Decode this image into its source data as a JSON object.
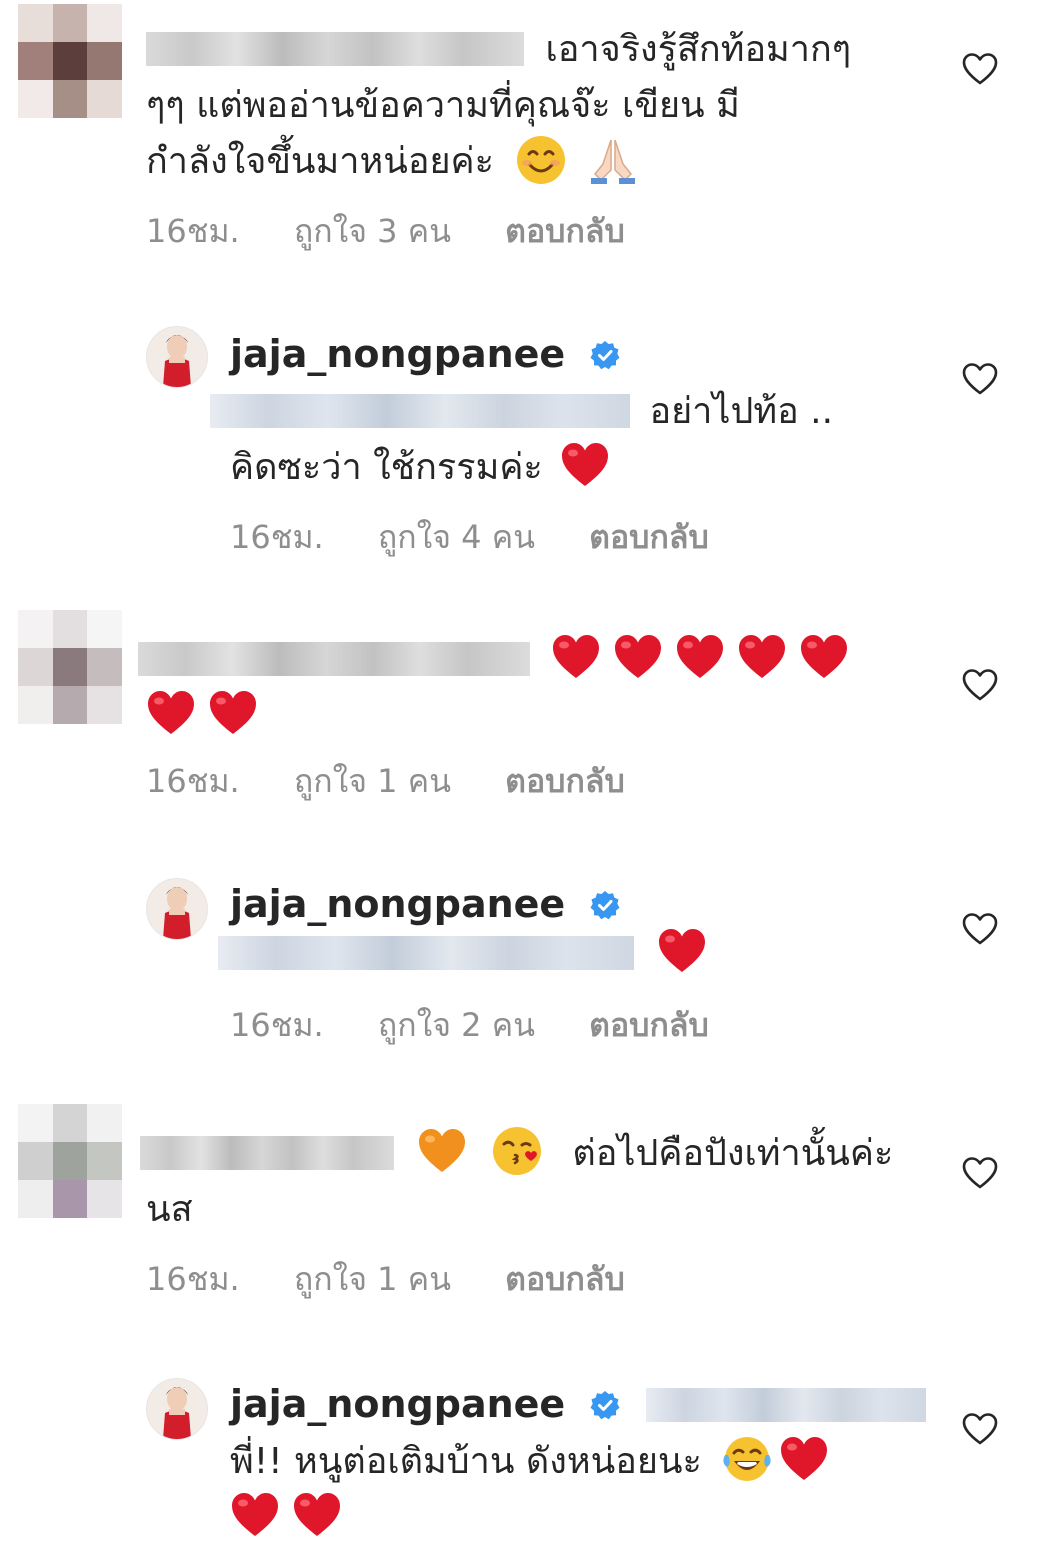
{
  "comments": [
    {
      "text_lines": [
        "เอาจริงรู้สึกท้อมากๆ",
        "ๆๆ แต่พออ่านข้อความที่คุณจ๊ะ เขียน มี",
        "กำลังใจขึ้นมาหน่อยค่ะ 😊🙏"
      ],
      "time": "16ชม.",
      "likes": "ถูกใจ 3 คน",
      "reply": "ตอบกลับ"
    },
    {
      "username": "jaja_nongpanee",
      "text_lines": [
        "อย่าไปท้อ ..",
        "คิดซะว่า ใช้กรรมค่ะ ❤️"
      ],
      "time": "16ชม.",
      "likes": "ถูกใจ 4 คน",
      "reply": "ตอบกลับ"
    },
    {
      "text_lines": [
        "❤️❤️❤️❤️❤️",
        "❤️❤️"
      ],
      "time": "16ชม.",
      "likes": "ถูกใจ 1 คน",
      "reply": "ตอบกลับ"
    },
    {
      "username": "jaja_nongpanee",
      "text_lines": [
        "❤️"
      ],
      "time": "16ชม.",
      "likes": "ถูกใจ 2 คน",
      "reply": "ตอบกลับ"
    },
    {
      "text_lines": [
        "🧡😘 ต่อไปคือปังเท่านั้นค่ะ",
        "นส"
      ],
      "time": "16ชม.",
      "likes": "ถูกใจ 1 คน",
      "reply": "ตอบกลับ"
    },
    {
      "username": "jaja_nongpanee",
      "text_lines": [
        "พี่!! หนูต่อเติมบ้าน ดังหน่อยนะ 😂❤️",
        "❤️❤️"
      ],
      "time": "",
      "likes": "",
      "reply": ""
    }
  ],
  "text": {
    "c1_l1": "เอาจริงรู้สึกท้อมากๆ",
    "c1_l2": "ๆๆ แต่พออ่านข้อความที่คุณจ๊ะ เขียน มี",
    "c1_l3": "กำลังใจขึ้นมาหน่อยค่ะ",
    "c2_l1": "อย่าไปท้อ ..",
    "c2_l2": "คิดซะว่า ใช้กรรมค่ะ",
    "c5_l1": "ต่อไปคือปังเท่านั้นค่ะ",
    "c5_l2": "นส",
    "c6_l1": "พี่!! หนูต่อเติมบ้าน ดังหน่อยนะ"
  },
  "icons": {
    "like": "heart-outline-icon",
    "verified": "verified-badge-icon",
    "verified_color": "#3897f0",
    "heart_color": "#e0162b"
  }
}
